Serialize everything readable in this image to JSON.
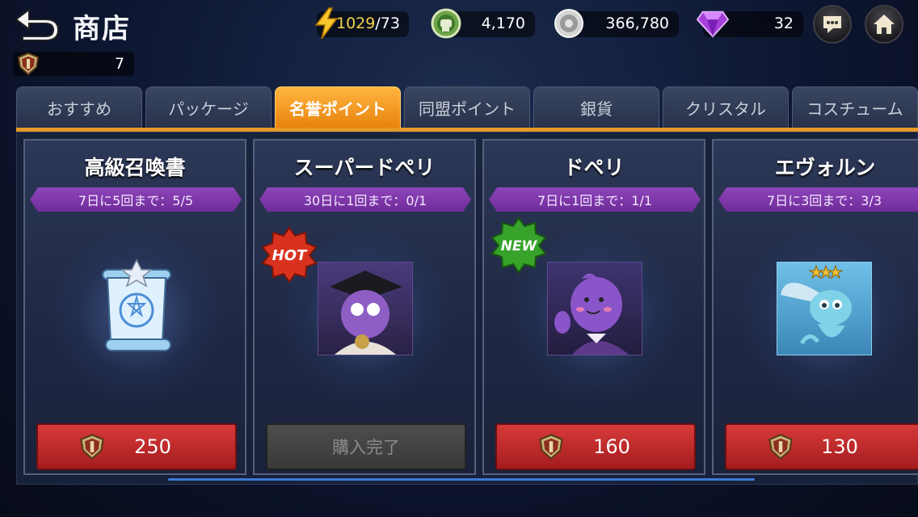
{
  "header": {
    "title": "商店",
    "energy_current": "1029",
    "energy_max": "/73",
    "coins": "4,170",
    "silver": "366,780",
    "gems": "32",
    "honor_points": "7"
  },
  "tabs": [
    {
      "label": "おすすめ"
    },
    {
      "label": "パッケージ"
    },
    {
      "label": "名誉ポイント"
    },
    {
      "label": "同盟ポイント"
    },
    {
      "label": "銀貨"
    },
    {
      "label": "クリスタル"
    },
    {
      "label": "コスチューム"
    }
  ],
  "active_tab": "名誉ポイント",
  "items": [
    {
      "name": "高級召喚書",
      "limit": "7日に5回まで：5/5",
      "price": "250",
      "purchased": false,
      "badge": ""
    },
    {
      "name": "スーパードペリ",
      "limit": "30日に1回まで：0/1",
      "price": "購入完了",
      "purchased": true,
      "badge": "HOT"
    },
    {
      "name": "ドペリ",
      "limit": "7日に1回まで：1/1",
      "price": "160",
      "purchased": false,
      "badge": "NEW"
    },
    {
      "name": "エヴォルン",
      "limit": "7日に3回まで：3/3",
      "price": "130",
      "purchased": false,
      "badge": ""
    }
  ],
  "colors": {
    "accent_orange": "#e79a26",
    "limit_purple": "#8e45ba",
    "buy_red": "#c62e30",
    "hot_red": "#d8321f",
    "new_green": "#37a32a"
  }
}
